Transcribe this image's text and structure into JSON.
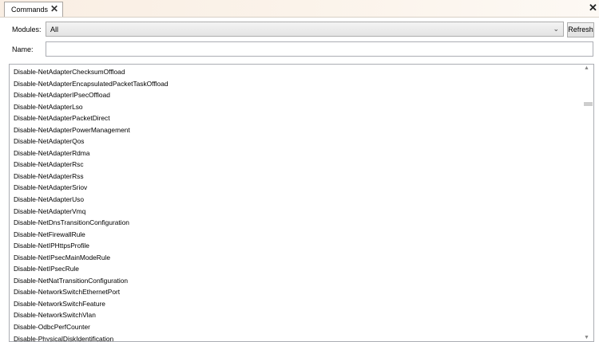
{
  "tab": {
    "label": "Commands",
    "close_glyph": "✕"
  },
  "window": {
    "close_glyph": "✕"
  },
  "filters": {
    "modules_label": "Modules:",
    "modules_value": "All",
    "dropdown_glyph": "⌄",
    "refresh_label": "Refresh",
    "name_label": "Name:",
    "name_value": ""
  },
  "commands": [
    "Disable-NetAdapterChecksumOffload",
    "Disable-NetAdapterEncapsulatedPacketTaskOffload",
    "Disable-NetAdapterIPsecOffload",
    "Disable-NetAdapterLso",
    "Disable-NetAdapterPacketDirect",
    "Disable-NetAdapterPowerManagement",
    "Disable-NetAdapterQos",
    "Disable-NetAdapterRdma",
    "Disable-NetAdapterRsc",
    "Disable-NetAdapterRss",
    "Disable-NetAdapterSriov",
    "Disable-NetAdapterUso",
    "Disable-NetAdapterVmq",
    "Disable-NetDnsTransitionConfiguration",
    "Disable-NetFirewallRule",
    "Disable-NetIPHttpsProfile",
    "Disable-NetIPsecMainModeRule",
    "Disable-NetIPsecRule",
    "Disable-NetNatTransitionConfiguration",
    "Disable-NetworkSwitchEthernetPort",
    "Disable-NetworkSwitchFeature",
    "Disable-NetworkSwitchVlan",
    "Disable-OdbcPerfCounter",
    "Disable-PhysicalDiskIdentification"
  ],
  "scrollbar": {
    "up_glyph": "▲",
    "down_glyph": "▼"
  }
}
